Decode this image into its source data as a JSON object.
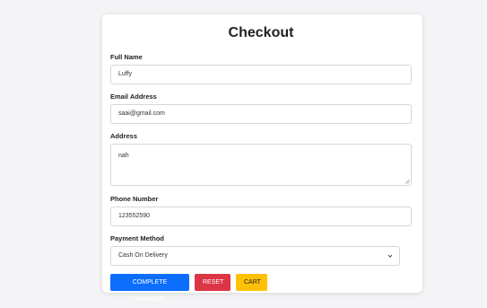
{
  "checkout": {
    "title": "Checkout",
    "full_name": {
      "label": "Full Name",
      "value": "Luffy"
    },
    "email": {
      "label": "Email Address",
      "value": "saai@gmail.com"
    },
    "address": {
      "label": "Address",
      "value": "nah"
    },
    "phone": {
      "label": "Phone Number",
      "value": "123552590"
    },
    "payment": {
      "label": "Payment Method",
      "selected": "Cash On Delivery"
    },
    "buttons": {
      "complete_payment": "COMPLETE PAYMENT",
      "reset": "RESET",
      "cart": "CART"
    }
  },
  "colors": {
    "background": "#f4f4f6",
    "card": "#ffffff",
    "primary": "#0d6efd",
    "danger": "#dc3545",
    "warning": "#ffc107"
  },
  "icons": {
    "select_arrow": "chevron-down-icon",
    "textarea_resize": "resize-handle-icon"
  }
}
